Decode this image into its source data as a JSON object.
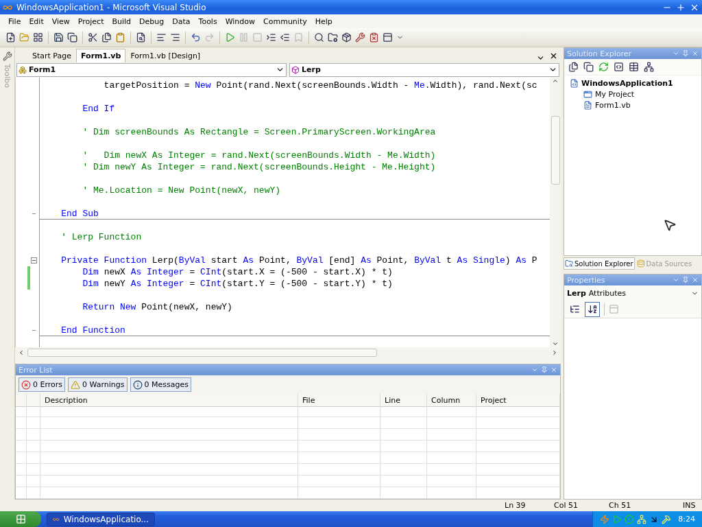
{
  "window": {
    "title": "WindowsApplication1 - Microsoft Visual Studio"
  },
  "menu": [
    "File",
    "Edit",
    "View",
    "Project",
    "Build",
    "Debug",
    "Data",
    "Tools",
    "Window",
    "Community",
    "Help"
  ],
  "toolbox": {
    "label": "Toolbo"
  },
  "editor": {
    "tabs": [
      {
        "label": "Start Page",
        "selected": false
      },
      {
        "label": "Form1.vb",
        "selected": true
      },
      {
        "label": "Form1.vb [Design]",
        "selected": false
      }
    ],
    "class_dropdown": "Form1",
    "method_dropdown": "Lerp",
    "lines": [
      {
        "kind": "code",
        "tokens": [
          {
            "kind": "plain",
            "text": "            targetPosition = "
          },
          {
            "kind": "keyword",
            "text": "New"
          },
          {
            "kind": "plain",
            "text": " Point(rand.Next(screenBounds.Width - "
          },
          {
            "kind": "keyword",
            "text": "Me"
          },
          {
            "kind": "plain",
            "text": ".Width), rand.Next(sc"
          }
        ]
      },
      {
        "kind": "blank"
      },
      {
        "kind": "code",
        "tokens": [
          {
            "kind": "keyword",
            "text": "        End If"
          }
        ]
      },
      {
        "kind": "blank"
      },
      {
        "kind": "code",
        "tokens": [
          {
            "kind": "comment",
            "text": "        ' Dim screenBounds As Rectangle = Screen.PrimaryScreen.WorkingArea"
          }
        ]
      },
      {
        "kind": "blank"
      },
      {
        "kind": "code",
        "tokens": [
          {
            "kind": "comment",
            "text": "        '   Dim newX As Integer = rand.Next(screenBounds.Width - Me.Width)"
          }
        ]
      },
      {
        "kind": "code",
        "tokens": [
          {
            "kind": "comment",
            "text": "        ' Dim newY As Integer = rand.Next(screenBounds.Height - Me.Height)"
          }
        ]
      },
      {
        "kind": "blank"
      },
      {
        "kind": "code",
        "tokens": [
          {
            "kind": "comment",
            "text": "        ' Me.Location = New Point(newX, newY)"
          }
        ]
      },
      {
        "kind": "blank"
      },
      {
        "kind": "code",
        "tokens": [
          {
            "kind": "keyword",
            "text": "    End Sub"
          }
        ],
        "block_end": true
      },
      {
        "kind": "blank"
      },
      {
        "kind": "code",
        "tokens": [
          {
            "kind": "comment",
            "text": "    ' Lerp Function"
          }
        ]
      },
      {
        "kind": "blank"
      },
      {
        "kind": "code",
        "tokens": [
          {
            "kind": "keyword",
            "text": "    Private Function"
          },
          {
            "kind": "plain",
            "text": " Lerp("
          },
          {
            "kind": "keyword",
            "text": "ByVal"
          },
          {
            "kind": "plain",
            "text": " start "
          },
          {
            "kind": "keyword",
            "text": "As"
          },
          {
            "kind": "plain",
            "text": " Point, "
          },
          {
            "kind": "keyword",
            "text": "ByVal"
          },
          {
            "kind": "plain",
            "text": " [end] "
          },
          {
            "kind": "keyword",
            "text": "As"
          },
          {
            "kind": "plain",
            "text": " Point, "
          },
          {
            "kind": "keyword",
            "text": "ByVal"
          },
          {
            "kind": "plain",
            "text": " t "
          },
          {
            "kind": "keyword",
            "text": "As Single"
          },
          {
            "kind": "plain",
            "text": ") "
          },
          {
            "kind": "keyword",
            "text": "As"
          },
          {
            "kind": "plain",
            "text": " P"
          }
        ],
        "collapsible": true
      },
      {
        "kind": "code",
        "tokens": [
          {
            "kind": "keyword",
            "text": "        Dim"
          },
          {
            "kind": "plain",
            "text": " newX "
          },
          {
            "kind": "keyword",
            "text": "As Integer"
          },
          {
            "kind": "plain",
            "text": " = "
          },
          {
            "kind": "keyword",
            "text": "CInt"
          },
          {
            "kind": "plain",
            "text": "(start.X = (-500 - start.X) * t)"
          }
        ],
        "changed": true
      },
      {
        "kind": "code",
        "tokens": [
          {
            "kind": "keyword",
            "text": "        Dim"
          },
          {
            "kind": "plain",
            "text": " newY "
          },
          {
            "kind": "keyword",
            "text": "As Integer"
          },
          {
            "kind": "plain",
            "text": " = "
          },
          {
            "kind": "keyword",
            "text": "CInt"
          },
          {
            "kind": "plain",
            "text": "(start.Y = (-500 - start.Y) * t)"
          }
        ],
        "changed": true
      },
      {
        "kind": "blank"
      },
      {
        "kind": "code",
        "tokens": [
          {
            "kind": "keyword",
            "text": "        Return New"
          },
          {
            "kind": "plain",
            "text": " Point(newX, newY)"
          }
        ]
      },
      {
        "kind": "blank"
      },
      {
        "kind": "code",
        "tokens": [
          {
            "kind": "keyword",
            "text": "    End Function"
          }
        ],
        "block_end": true
      }
    ]
  },
  "error_list": {
    "title": "Error List",
    "filters": [
      {
        "kind": "error",
        "label": "0 Errors",
        "selected": true
      },
      {
        "kind": "warning",
        "label": "0 Warnings",
        "selected": true
      },
      {
        "kind": "message",
        "label": "0 Messages",
        "selected": true
      }
    ],
    "columns": [
      "Description",
      "File",
      "Line",
      "Column",
      "Project"
    ]
  },
  "solution_explorer": {
    "title": "Solution Explorer",
    "tree": [
      {
        "label": "WindowsApplication1",
        "kind": "solution",
        "children": [
          {
            "label": "My Project",
            "kind": "project"
          },
          {
            "label": "Form1.vb",
            "kind": "file"
          }
        ]
      }
    ]
  },
  "panel_tabs": [
    {
      "label": "Solution Explorer",
      "selected": true
    },
    {
      "label": "Data Sources",
      "selected": false
    }
  ],
  "properties": {
    "title": "Properties",
    "object": "Lerp",
    "object_type": "Attributes",
    "views": [
      {
        "kind": "categorized",
        "selected": false
      },
      {
        "kind": "alphabetical",
        "selected": true
      }
    ]
  },
  "status_bar": {
    "line": "Ln 39",
    "column": "Col 51",
    "char": "Ch 51",
    "mode": "INS"
  },
  "taskbar": {
    "task": "WindowsApplicatio...",
    "clock": "8:24"
  }
}
